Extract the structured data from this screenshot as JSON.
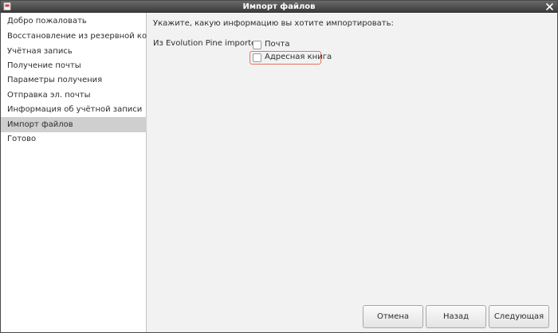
{
  "window": {
    "title": "Импорт файлов"
  },
  "sidebar": {
    "items": [
      {
        "label": "Добро пожаловать"
      },
      {
        "label": "Восстановление из резервной копии"
      },
      {
        "label": "Учётная запись"
      },
      {
        "label": "Получение почты"
      },
      {
        "label": "Параметры получения"
      },
      {
        "label": "Отправка эл. почты"
      },
      {
        "label": "Информация об учётной записи"
      },
      {
        "label": "Импорт файлов",
        "active": true
      },
      {
        "label": "Готово"
      }
    ]
  },
  "main": {
    "heading": "Укажите, какую информацию вы хотите импортировать:",
    "importer_label": "Из Evolution Pine importer:",
    "options": [
      {
        "label": "Почта",
        "checked": false
      },
      {
        "label": "Адресная книга",
        "checked": false,
        "highlighted": true
      }
    ]
  },
  "buttons": {
    "cancel": "Отмена",
    "back": "Назад",
    "next": "Следующая"
  },
  "colors": {
    "titlebar": "#4a4a4a",
    "selection": "#cfcfcf",
    "highlight": "#e8745c"
  },
  "icons": [
    "app-icon",
    "close-icon"
  ]
}
